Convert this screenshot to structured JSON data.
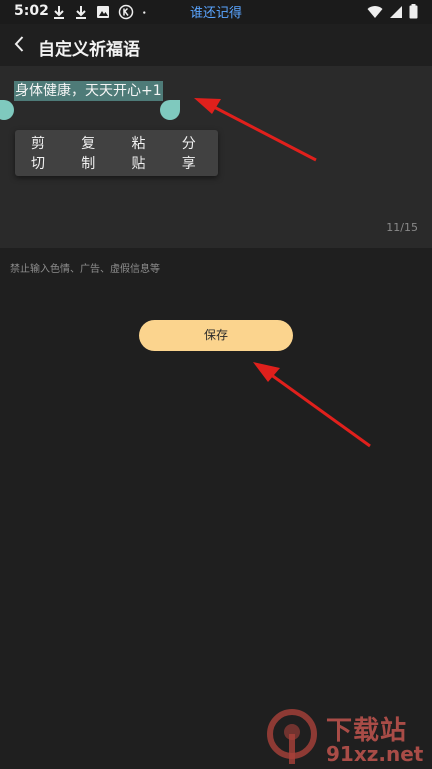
{
  "status_bar": {
    "time": "5:02",
    "app_name": "谁还记得",
    "left_icons": [
      "download-icon",
      "download-icon",
      "image-icon",
      "k-circle-icon",
      "dot-icon"
    ],
    "right_icons": [
      "wifi-icon",
      "signal-icon",
      "battery-icon"
    ]
  },
  "header": {
    "title": "自定义祈福语",
    "back_icon": "back-chevron-icon"
  },
  "editor": {
    "text": "身体健康，天天开心+1",
    "char_count": "11/15",
    "context_menu": [
      "剪切",
      "复制",
      "粘贴",
      "分享"
    ]
  },
  "hint": "禁止输入色情、广告、虚假信息等",
  "save_button": {
    "label": "保存"
  },
  "colors": {
    "background": "#1f1f1f",
    "editor_bg": "#2a2a2a",
    "selection": "#4e7b78",
    "handle": "#7fc9be",
    "save_button": "#fbd48e",
    "annotation": "#e0201c",
    "status_app_name": "#5aa5ff"
  },
  "watermark": {
    "title": "下载站",
    "domain": "91xz.net"
  }
}
